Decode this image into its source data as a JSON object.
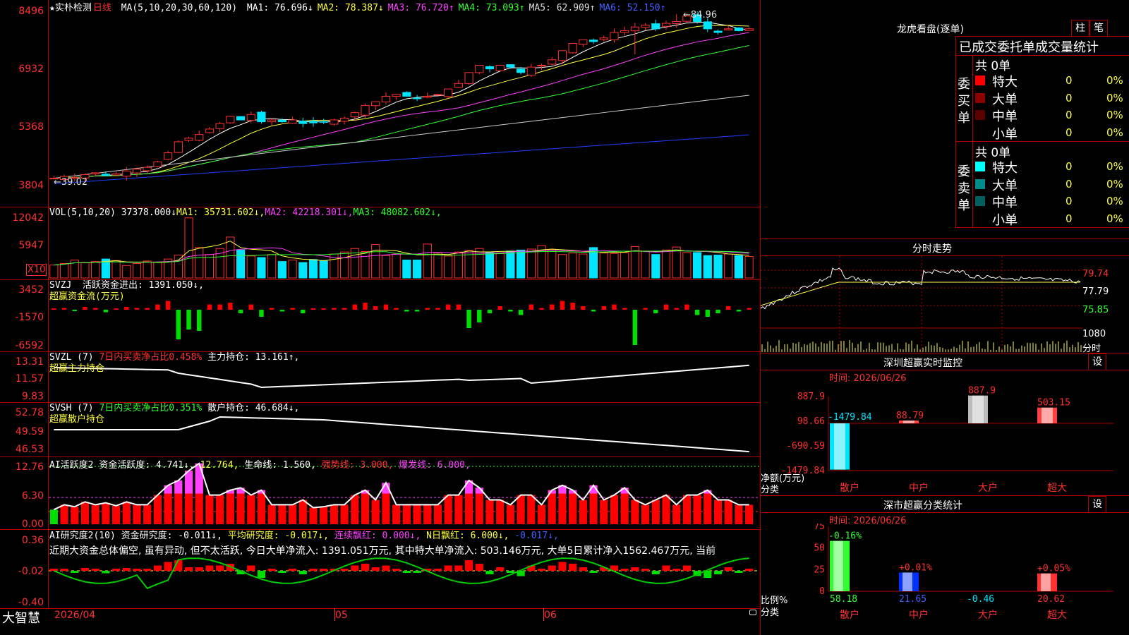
{
  "left_axis_max_visible": "8496",
  "main": {
    "title": "实朴检测",
    "period": "日线",
    "ma_label": "MA(5,10,20,30,60,120)",
    "mas": [
      {
        "label": "MA1:",
        "value": "76.696↓",
        "color": "#ffffff"
      },
      {
        "label": "MA2:",
        "value": "78.387↓",
        "color": "#ffff40"
      },
      {
        "label": "MA3:",
        "value": "76.720↑",
        "color": "#ff40ff"
      },
      {
        "label": "MA4:",
        "value": "73.093↑",
        "color": "#30ff30"
      },
      {
        "label": "MA5:",
        "value": "62.909↑",
        "color": "#dddddd"
      },
      {
        "label": "MA6:",
        "value": "52.150↑",
        "color": "#4060ff"
      }
    ],
    "y_labels": [
      "8496",
      "6932",
      "5368",
      "3804"
    ],
    "high_label": "84.96",
    "low_label": "39.02"
  },
  "vol": {
    "title": "VOL(5,10,20)",
    "value": "37378.000↓",
    "mas": [
      {
        "label": "MA1:",
        "value": "35731.602↓",
        "color": "#ffff40"
      },
      {
        "label": "MA2:",
        "value": "42218.301↓",
        "color": "#ff40ff"
      },
      {
        "label": "MA3:",
        "value": "48082.602↓",
        "color": "#30ff30"
      }
    ],
    "y_labels": [
      "12042",
      "5947"
    ],
    "unit": "X10"
  },
  "svzj": {
    "title": "SVZJ",
    "label": "活跃资金进出:",
    "value": "1391.050↓,",
    "sub": "超赢资金流(万元)",
    "y_labels": [
      "3452",
      "-1570",
      "-6592"
    ]
  },
  "svzl": {
    "title": "SVZL (7)",
    "label": "7日内买卖净占比0.458%",
    "label2": "主力持仓:",
    "value": "13.161↑,",
    "sub": "超赢主力持仓",
    "y_labels": [
      "13.31",
      "11.57",
      "9.83"
    ]
  },
  "svsh": {
    "title": "SVSH (7)",
    "label": "7日内买卖净占比0.351%",
    "label2": "散户持仓:",
    "value": "46.684↓,",
    "sub": "超赢散户持仓",
    "y_labels": [
      "52.78",
      "49.59",
      "46.53"
    ]
  },
  "ai1": {
    "title": "AI活跃度2",
    "label": "资金活跃度:",
    "value": "4.741↓,",
    "v2": "12.764,",
    "life_label": "生命线:",
    "life_value": "1.560,",
    "strong": "强势线: 3.000,",
    "burst": "爆发线: 6.000,",
    "y_labels": [
      "12.76",
      "6.30",
      "0.00"
    ]
  },
  "ai2": {
    "title": "AI研究度2(10)",
    "label": "资金研究度:",
    "value": "-0.011↓,",
    "avg": "平均研究度: -0.017↓,",
    "red": "连续飘红: 0.000↓,",
    "nday": "N日飘红: 6.000↓,",
    "last": "-0.017↓,",
    "comment": "近期大资金总体偏空, 虽有异动, 但不太活跃, 今日大单净流入: 1391.051万元, 其中特大单净流入: 503.146万元, 大单5日累计净入1562.467万元, 当前",
    "y_labels": [
      "0.36",
      "-0.02",
      "-0.40"
    ]
  },
  "bottom": {
    "brand": "大智慧",
    "dates": [
      "2026/04",
      "05",
      "06"
    ]
  },
  "right": {
    "lhb_title": "龙虎看盘(逐单)",
    "btn_zhu": "柱",
    "btn_bi": "笔",
    "stat_title": "已成交委托单成交量统计",
    "buy": {
      "side": "委买单",
      "total": "共 0单",
      "rows": [
        {
          "name": "特大",
          "count": "0",
          "pct": "0%",
          "color": "#ff0000"
        },
        {
          "name": "大单",
          "count": "0",
          "pct": "0%",
          "color": "#8b0000"
        },
        {
          "name": "中单",
          "count": "0",
          "pct": "0%",
          "color": "#5a0000"
        },
        {
          "name": "小单",
          "count": "0",
          "pct": "0%",
          "color": "#000000"
        }
      ]
    },
    "sell": {
      "side": "委卖单",
      "total": "共 0单",
      "rows": [
        {
          "name": "特大",
          "count": "0",
          "pct": "0%",
          "color": "#00ffff"
        },
        {
          "name": "大单",
          "count": "0",
          "pct": "0%",
          "color": "#008b8b"
        },
        {
          "name": "中单",
          "count": "0",
          "pct": "0%",
          "color": "#006060"
        },
        {
          "name": "小单",
          "count": "0",
          "pct": "0%",
          "color": "#000000"
        }
      ]
    },
    "fenshi": {
      "title": "分时走势",
      "y_labels": [
        "79.74",
        "77.79",
        "75.85"
      ],
      "vol_label": "1080",
      "unit": "分时"
    },
    "sz_monitor": {
      "title": "深圳超赢实时监控",
      "btn": "设",
      "time": "时间: 2026/06/26",
      "y_labels": [
        "887.9",
        "98.66",
        "-690.59",
        "-1479.84"
      ],
      "ylabel": "净额(万元)",
      "xlabel": "分类",
      "categories": [
        "散户",
        "中户",
        "大户",
        "超大"
      ],
      "values": [
        -1479.84,
        88.79,
        887.9,
        503.15
      ],
      "value_labels": [
        "-1479.84",
        "88.79",
        "887.9",
        "503.15"
      ]
    },
    "sz_stats": {
      "title": "深市超赢分类统计",
      "btn": "设",
      "time": "时间: 2026/06/26",
      "y_labels": [
        "75",
        "50",
        "25",
        "0"
      ],
      "ylabel": "比例%",
      "xlabel": "分类",
      "categories": [
        "散户",
        "中户",
        "大户",
        "超大"
      ],
      "top_labels": [
        "-0.16%",
        "+0.01%",
        "",
        "+0.05%"
      ],
      "values": [
        58.18,
        21.65,
        -0.46,
        20.62
      ],
      "value_labels": [
        "58.18",
        "21.65",
        "-0.46",
        "20.62"
      ]
    }
  },
  "chart_data": [
    {
      "type": "candlestick",
      "title": "实朴检测 日线",
      "ylim": [
        38,
        86
      ],
      "x_labels": [
        "2026/04",
        "05",
        "06"
      ],
      "closes": [
        40,
        40.5,
        40.2,
        41,
        41.5,
        40.8,
        41.2,
        42,
        42.5,
        43,
        44.5,
        47,
        50,
        51,
        52,
        53.5,
        55,
        57,
        56,
        57.5,
        55.5,
        56,
        55.5,
        56,
        55,
        55.2,
        55.5,
        56,
        56.5,
        58,
        60,
        61,
        62.5,
        63,
        62.5,
        62,
        62.5,
        63,
        64.5,
        66,
        69,
        71,
        70,
        71,
        70.5,
        69,
        70.5,
        71,
        72.5,
        75,
        77,
        78,
        77.5,
        78.5,
        80,
        80.5,
        81.5,
        82,
        81,
        82.5,
        83,
        84.5,
        83,
        81,
        80,
        81,
        80.5,
        81
      ],
      "ma_series": [
        "MA1",
        "MA2",
        "MA3",
        "MA4",
        "MA5",
        "MA6"
      ]
    },
    {
      "type": "bar",
      "title": "VOL(5,10,20)",
      "ylim": [
        0,
        13000
      ],
      "values": [
        2600,
        2900,
        3600,
        3100,
        3300,
        3800,
        3500,
        2500,
        2900,
        3400,
        3200,
        3800,
        4600,
        12042,
        6100,
        4700,
        5900,
        8200,
        5600,
        4400,
        4100,
        4700,
        3300,
        3600,
        3100,
        3700,
        3500,
        4800,
        5200,
        5900,
        5300,
        6700,
        4500,
        4800,
        3600,
        3600,
        6800,
        5100,
        4400,
        5200,
        5500,
        5900,
        5100,
        4900,
        5400,
        5600,
        5800,
        6500,
        5700,
        4700,
        5000,
        4800,
        6100,
        5000,
        4900,
        5100,
        6300,
        5400,
        4700,
        5600,
        6200,
        5100,
        5100,
        4500,
        4600,
        4800,
        4500,
        4300
      ]
    }
  ]
}
